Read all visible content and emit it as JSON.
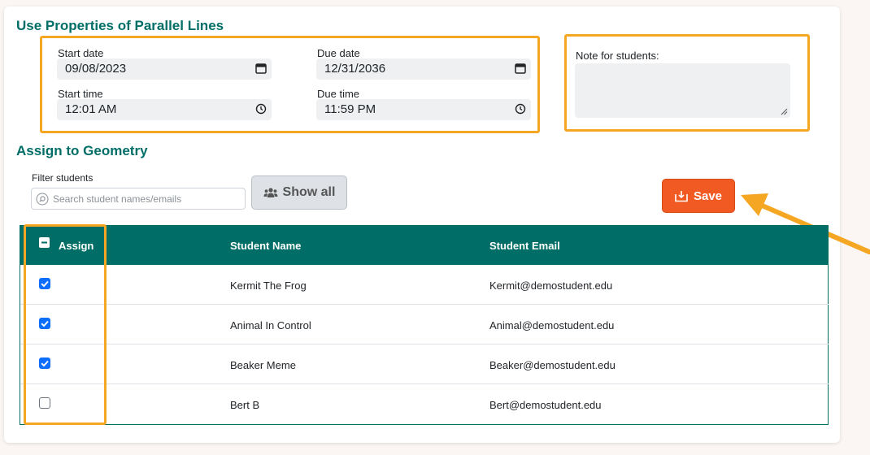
{
  "assignment": {
    "title": "Use Properties of Parallel Lines",
    "start_date_label": "Start date",
    "start_date_value": "09/08/2023",
    "due_date_label": "Due date",
    "due_date_value": "12/31/2036",
    "start_time_label": "Start time",
    "start_time_value": "12:01 AM",
    "due_time_label": "Due time",
    "due_time_value": "11:59 PM",
    "note_label": "Note for students:",
    "note_value": ""
  },
  "assign_section": {
    "title": "Assign to Geometry",
    "filter_label": "Filter students",
    "search_placeholder": "Search student names/emails",
    "show_all_label": "Show all",
    "save_label": "Save"
  },
  "table": {
    "headers": [
      "Assign",
      "Student Name",
      "Student Email"
    ],
    "rows": [
      {
        "checked": true,
        "name": "Kermit The Frog",
        "email": "Kermit@demostudent.edu"
      },
      {
        "checked": true,
        "name": "Animal In Control",
        "email": "Animal@demostudent.edu"
      },
      {
        "checked": true,
        "name": "Beaker Meme",
        "email": "Beaker@demostudent.edu"
      },
      {
        "checked": false,
        "name": "Bert B",
        "email": "Bert@demostudent.edu"
      }
    ]
  },
  "colors": {
    "accent": "#006e67",
    "save": "#f15a22",
    "highlight": "#f5a623",
    "checkbox": "#0d6efd"
  },
  "icons": {
    "date": "calendar-icon",
    "time": "clock-icon",
    "search": "search-icon",
    "show_all": "users-icon",
    "save": "save-icon",
    "select_all": "minus-square-icon"
  }
}
